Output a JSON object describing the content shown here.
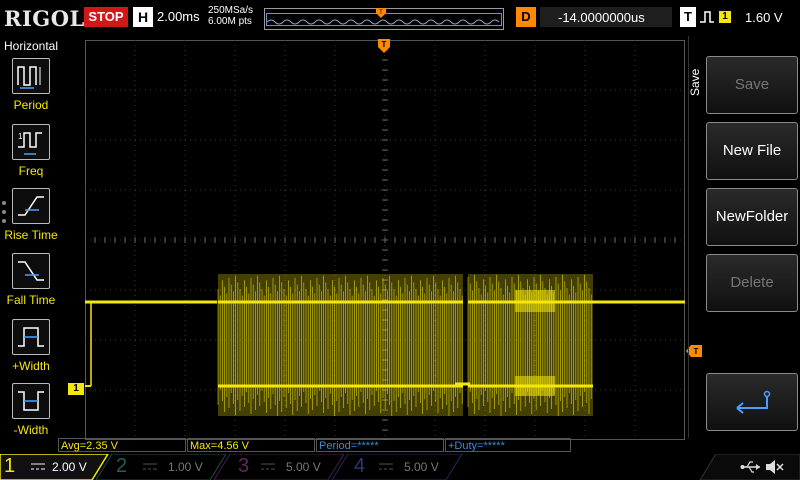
{
  "header": {
    "brand": "RIGOL",
    "run_status": "STOP",
    "h_label": "H",
    "timebase": "2.00ms",
    "sample_rate": "250MSa/s",
    "memory_depth": "6.00M pts",
    "trigger_pos_label": "T",
    "delay_label": "D",
    "delay": "-14.0000000us",
    "trigger_label": "T",
    "trigger_edge_icon": "rising-edge-icon",
    "trigger_source": "1",
    "trigger_level": "1.60 V"
  },
  "left_menu": {
    "title": "Horizontal",
    "items": [
      {
        "label": "Period",
        "icon": "period-icon"
      },
      {
        "label": "Freq",
        "icon": "frequency-icon"
      },
      {
        "label": "Rise Time",
        "icon": "rise-time-icon"
      },
      {
        "label": "Fall Time",
        "icon": "fall-time-icon"
      },
      {
        "label": "+Width",
        "icon": "positive-width-icon"
      },
      {
        "label": "-Width",
        "icon": "negative-width-icon"
      }
    ]
  },
  "right_menu": {
    "title": "Save",
    "buttons": [
      {
        "label": "Save",
        "enabled": false
      },
      {
        "label": "New File",
        "enabled": true
      },
      {
        "label": "NewFolder",
        "enabled": true
      },
      {
        "label": "Delete",
        "enabled": false
      }
    ],
    "back_icon": "return-arrow-icon"
  },
  "measurements": {
    "avg": "Avg=2.35 V",
    "max": "Max=4.56 V",
    "period": "Period=*****",
    "duty": "+Duty=*****"
  },
  "channels": [
    {
      "num": "1",
      "scale": "2.00 V",
      "color": "#f5e70a",
      "active": true
    },
    {
      "num": "2",
      "scale": "1.00 V",
      "color": "#16c7c7",
      "active": false
    },
    {
      "num": "3",
      "scale": "5.00 V",
      "color": "#e040e0",
      "active": false
    },
    {
      "num": "4",
      "scale": "5.00 V",
      "color": "#3a6ad8",
      "active": false
    }
  ],
  "channel_markers": {
    "ch1": "1"
  },
  "status_icons": [
    "usb-icon",
    "sound-muted-icon"
  ],
  "colors": {
    "ch1": "#f5e70a",
    "trigger": "#ff8a00",
    "stop": "#d01818"
  }
}
